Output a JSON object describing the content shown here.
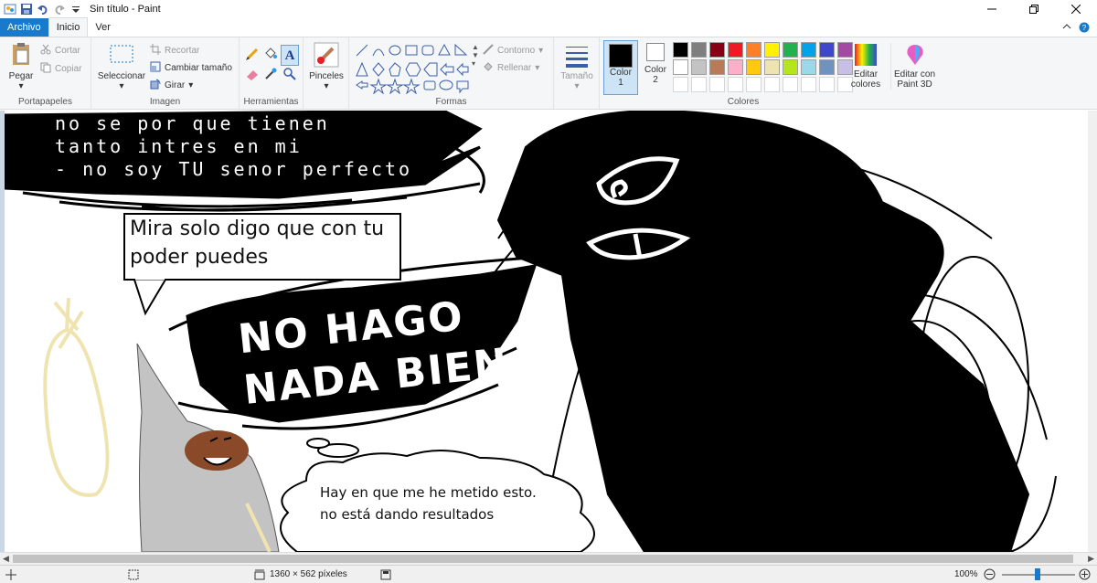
{
  "window": {
    "title": "Sin título - Paint"
  },
  "tabs": {
    "file": "Archivo",
    "home": "Inicio",
    "view": "Ver"
  },
  "clipboard": {
    "paste": "Pegar",
    "cut": "Cortar",
    "copy": "Copiar",
    "label": "Portapapeles"
  },
  "image": {
    "select": "Seleccionar",
    "crop": "Recortar",
    "resize": "Cambiar tamaño",
    "rotate": "Girar",
    "label": "Imagen"
  },
  "tools": {
    "label": "Herramientas"
  },
  "brushes": {
    "label": "Pinceles"
  },
  "shapes": {
    "outline": "Contorno",
    "fill": "Rellenar",
    "label": "Formas"
  },
  "size": {
    "label": "Tamaño"
  },
  "colors": {
    "color1": "Color 1",
    "color2": "Color 2",
    "edit": "Editar colores",
    "paint3d": "Editar con Paint 3D",
    "label": "Colores",
    "palette_row1": [
      "#000000",
      "#7f7f7f",
      "#880015",
      "#ed1c24",
      "#ff7f27",
      "#fff200",
      "#22b14c",
      "#00a2e8",
      "#3f48cc",
      "#a349a4"
    ],
    "palette_row2": [
      "#ffffff",
      "#c3c3c3",
      "#b97a57",
      "#ffaec9",
      "#ffc90e",
      "#efe4b0",
      "#b5e61d",
      "#99d9ea",
      "#7092be",
      "#c8bfe7"
    ]
  },
  "canvas": {
    "scribble_text_top": [
      "no se por que tienen",
      "tanto intres en mi",
      "- no soy TU  senor perfecto"
    ],
    "speech_bubble": [
      "Mira solo digo que con tu",
      "poder puedes"
    ],
    "shout_text": [
      "NO HAGO",
      "NADA BIEN"
    ],
    "thought_bubble": [
      "Hay en que me he metido esto.",
      "no está dando resultados"
    ]
  },
  "status": {
    "dimensions": "1360 × 562 píxeles",
    "zoom": "100%"
  }
}
